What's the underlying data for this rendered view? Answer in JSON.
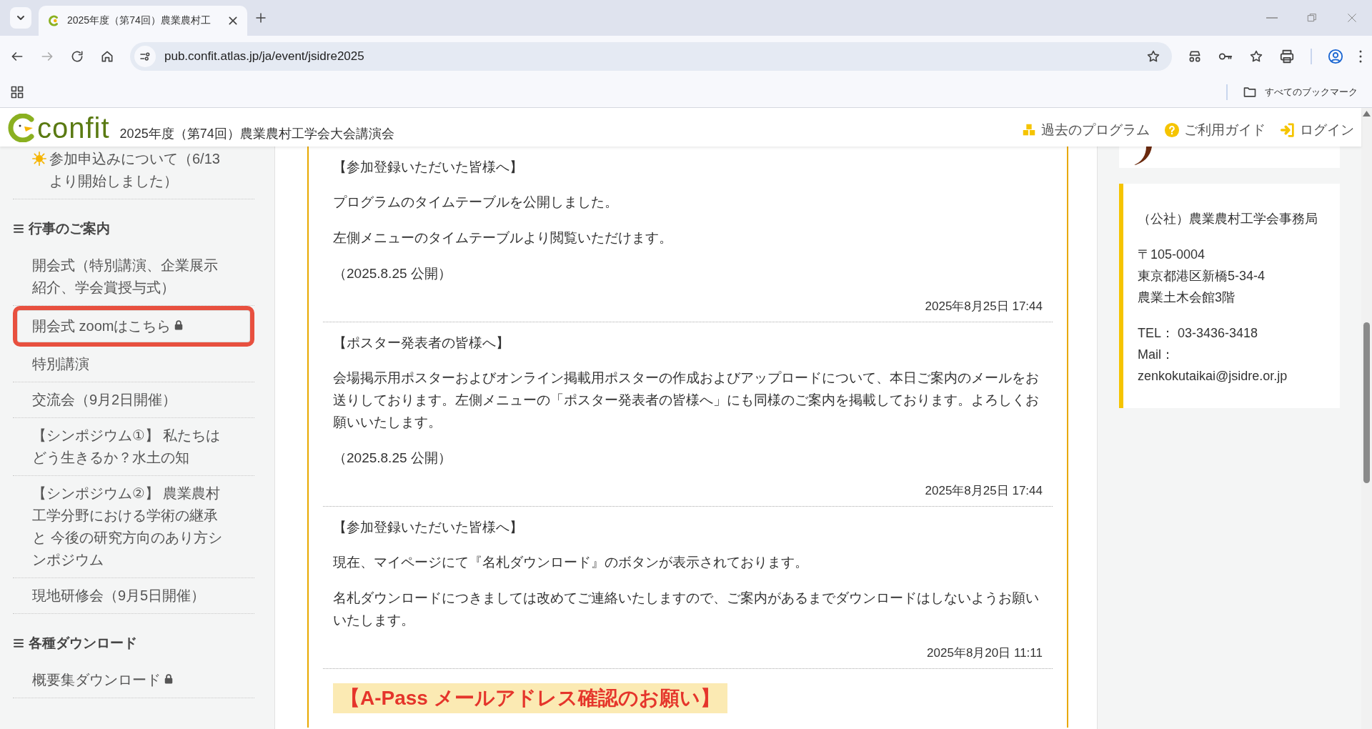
{
  "browser": {
    "tab_title": "2025年度（第74回）農業農村工",
    "url": "pub.confit.atlas.jp/ja/event/jsidre2025",
    "bookmarks_label": "すべてのブックマーク"
  },
  "site_header": {
    "logo_text": "confit",
    "event_title": "2025年度（第74回）農業農村工学会大会講演会",
    "links": [
      {
        "kind": "boxes",
        "label": "過去のプログラム"
      },
      {
        "kind": "help",
        "label": "ご利用ガイド"
      },
      {
        "kind": "login",
        "label": "ログイン"
      }
    ]
  },
  "sidebar": {
    "sections": [
      {
        "items": [
          {
            "kind": "sun",
            "label": "参加申込みについて（6/13より開始しました）",
            "locked": false,
            "highlighted": false
          }
        ]
      },
      {
        "heading": "行事のご案内",
        "items": [
          {
            "kind": "plain",
            "label": "開会式（特別講演、企業展示紹介、学会賞授与式）",
            "locked": false,
            "highlighted": false
          },
          {
            "kind": "plain",
            "label": "開会式 zoomはこちら",
            "locked": true,
            "highlighted": true
          },
          {
            "kind": "plain",
            "label": "特別講演",
            "locked": false,
            "highlighted": false
          },
          {
            "kind": "plain",
            "label": "交流会（9月2日開催）",
            "locked": false,
            "highlighted": false
          },
          {
            "kind": "plain",
            "label": "【シンポジウム①】 私たちはどう生きるか？水土の知",
            "locked": false,
            "highlighted": false
          },
          {
            "kind": "plain",
            "label": "【シンポジウム②】 農業農村工学分野における学術の継承と 今後の研究方向のあり方シンポジウム",
            "locked": false,
            "highlighted": false
          },
          {
            "kind": "plain",
            "label": "現地研修会（9月5日開催）",
            "locked": false,
            "highlighted": false
          }
        ]
      },
      {
        "heading": "各種ダウンロード",
        "items": [
          {
            "kind": "plain",
            "label": "概要集ダウンロード",
            "locked": true,
            "highlighted": false
          }
        ]
      }
    ]
  },
  "news": [
    {
      "title": "【参加登録いただいた皆様へ】",
      "paragraphs": [
        "プログラムのタイムテーブルを公開しました。",
        "左側メニューのタイムテーブルより閲覧いただけます。",
        "（2025.8.25 公開）"
      ],
      "date": "2025年8月25日 17:44"
    },
    {
      "title": "【ポスター発表者の皆様へ】",
      "paragraphs": [
        "会場掲示用ポスターおよびオンライン掲載用ポスターの作成およびアップロードについて、本日ご案内のメールをお送りしております。左側メニューの「ポスター発表者の皆様へ」にも同様のご案内を掲載しております。よろしくお願いいたします。",
        "（2025.8.25 公開）"
      ],
      "date": "2025年8月25日 17:44"
    },
    {
      "title": "【参加登録いただいた皆様へ】",
      "paragraphs": [
        "現在、マイページにて『名札ダウンロード』のボタンが表示されております。",
        "名札ダウンロードにつきましては改めてご連絡いたしますので、ご案内があるまでダウンロードはしないようお願いいたします。"
      ],
      "date": "2025年8月20日 11:11"
    }
  ],
  "highlight_heading": "【A-Pass メールアドレス確認のお願い】",
  "contact": {
    "organization": "（公社）農業農村工学会事務局",
    "address_lines": [
      "〒105-0004",
      "東京都港区新橋5-34-4",
      "農業土木会館3階"
    ],
    "tel": "TEL： 03-3436-3418",
    "mail_label": "Mail：",
    "email": "zenkokutaikai@jsidre.or.jp"
  }
}
